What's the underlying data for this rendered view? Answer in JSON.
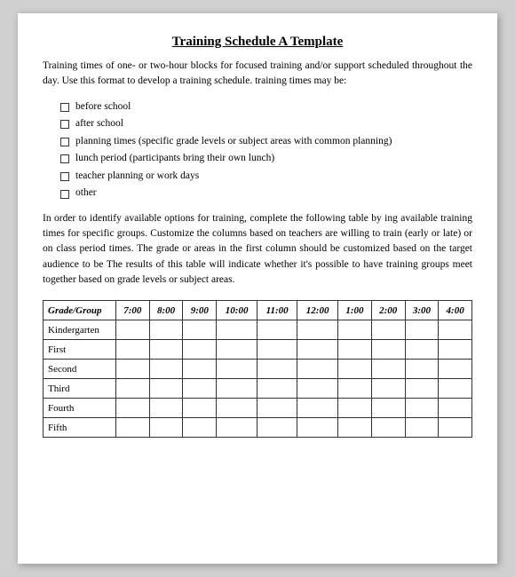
{
  "title": "Training Schedule A Template",
  "intro": "Training times of one- or two-hour blocks for focused training and/or support scheduled throughout the day. Use this format to develop a training schedule. training times may be:",
  "checklist": [
    "before school",
    "after school",
    "planning times (specific grade levels or subject areas with common planning)",
    "lunch period (participants bring their own lunch)",
    "teacher planning or work days",
    "other"
  ],
  "body_text": "In order to identify available options for training, complete the following table by ing available training times for specific groups. Customize the columns based on teachers are willing to train (early or late) or on class period times. The grade or areas in the first column should be customized based on the target audience to be The results of this table will indicate whether it's possible to have training groups meet together based on grade levels or subject areas.",
  "table": {
    "headers": [
      "Grade/Group",
      "7:00",
      "8:00",
      "9:00",
      "10:00",
      "11:00",
      "12:00",
      "1:00",
      "2:00",
      "3:00",
      "4:00"
    ],
    "rows": [
      "Kindergarten",
      "First",
      "Second",
      "Third",
      "Fourth",
      "Fifth"
    ]
  }
}
